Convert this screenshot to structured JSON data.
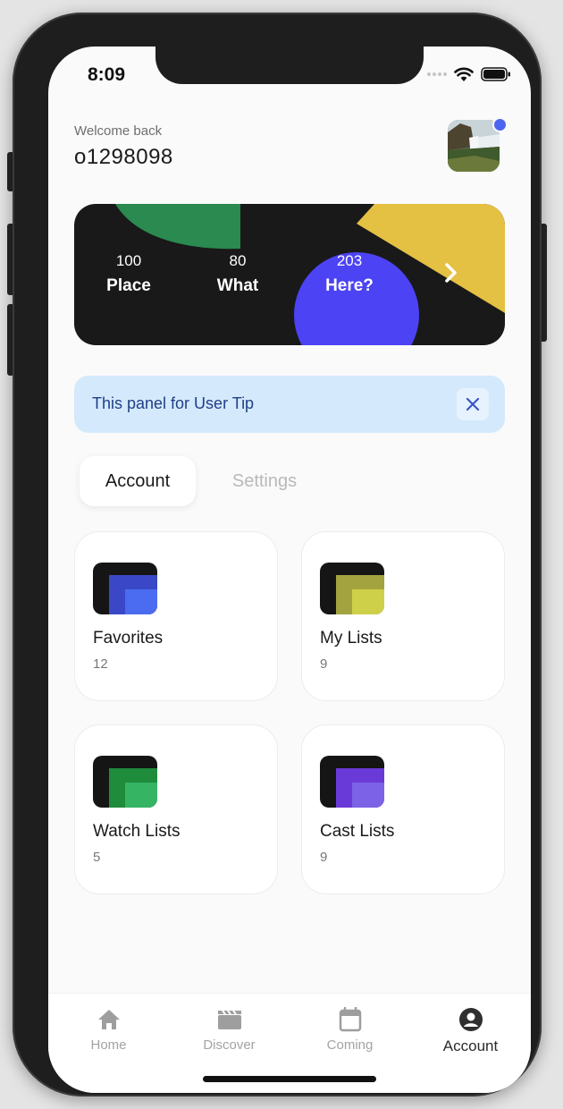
{
  "status_bar": {
    "time": "8:09"
  },
  "header": {
    "welcome": "Welcome back",
    "username": "o1298098"
  },
  "banner": {
    "stats": [
      {
        "value": "100",
        "label": "Place"
      },
      {
        "value": "80",
        "label": "What"
      },
      {
        "value": "203",
        "label": "Here?"
      }
    ],
    "colors": {
      "background": "#191919",
      "green": "#2a8a4f",
      "yellow": "#e4c043",
      "blue": "#4c43f5"
    }
  },
  "tip": {
    "text": "This panel for User Tip"
  },
  "tabs": {
    "account": "Account",
    "settings": "Settings"
  },
  "cards": [
    {
      "title": "Favorites",
      "count": "12",
      "icon": "blue-stack-icon"
    },
    {
      "title": "My Lists",
      "count": "9",
      "icon": "yellow-stack-icon"
    },
    {
      "title": "Watch Lists",
      "count": "5",
      "icon": "green-stack-icon"
    },
    {
      "title": "Cast Lists",
      "count": "9",
      "icon": "purple-stack-icon"
    }
  ],
  "nav": [
    {
      "label": "Home",
      "icon": "home-icon"
    },
    {
      "label": "Discover",
      "icon": "clapperboard-icon"
    },
    {
      "label": "Coming",
      "icon": "calendar-icon"
    },
    {
      "label": "Account",
      "icon": "account-circle-icon",
      "active": true
    }
  ]
}
